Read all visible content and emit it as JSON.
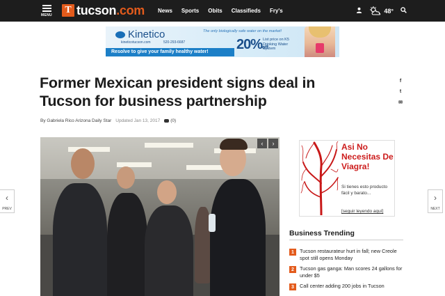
{
  "nav": {
    "menu_label": "MENU",
    "logo_text": "tucson",
    "logo_suffix": ".com",
    "logo_mark": "T",
    "links": [
      "News",
      "Sports",
      "Obits",
      "Classifieds",
      "Fry's"
    ],
    "temperature": "48°",
    "icons": [
      "user-icon",
      "weather-cloud-sun-icon",
      "search-icon"
    ]
  },
  "ad_banner": {
    "brand": "Kinetico",
    "tagline": "The only biologically safe water on the market!",
    "site": "kineticotucson.com",
    "phone": "520-293-6687",
    "strip": "Resolve to give your family healthy water!",
    "percent": "20%",
    "percent_suffix": "off",
    "offer": "List price on K5 Drinking Water System"
  },
  "article": {
    "headline": "Former Mexican president signs deal in Tucson for business partnership",
    "byline": "By Gabriela Rico Arizona Daily Star",
    "updated": "Updated Jan 13, 2017",
    "comments": "(0)"
  },
  "share": [
    "f",
    "t",
    "✉"
  ],
  "photo": {
    "prev_arrow": "‹",
    "next_arrow": "›"
  },
  "side_ad": {
    "title": "Asi No Necesitas De Viagra!",
    "desc": "Si tienes esto producto fácil y barato...",
    "more": "[seguir leyendo aquí]"
  },
  "trending": {
    "title": "Business Trending",
    "items": [
      {
        "num": "1",
        "text": "Tucson restaurateur hurt in fall; new Creole spot still opens Monday"
      },
      {
        "num": "2",
        "text": "Tucson gas ganga: Man scores 24 gallons for under $5"
      },
      {
        "num": "3",
        "text": "Call center adding 200 jobs in Tucson"
      }
    ]
  },
  "pager": {
    "prev": "PREV",
    "next": "NEXT",
    "prev_chevron": "‹",
    "next_chevron": "›"
  },
  "colors": {
    "nav_bg": "#1d1d1d",
    "accent": "#e35b1c",
    "ad_red": "#cc1c1c",
    "ad_blue": "#1c7fc7"
  }
}
